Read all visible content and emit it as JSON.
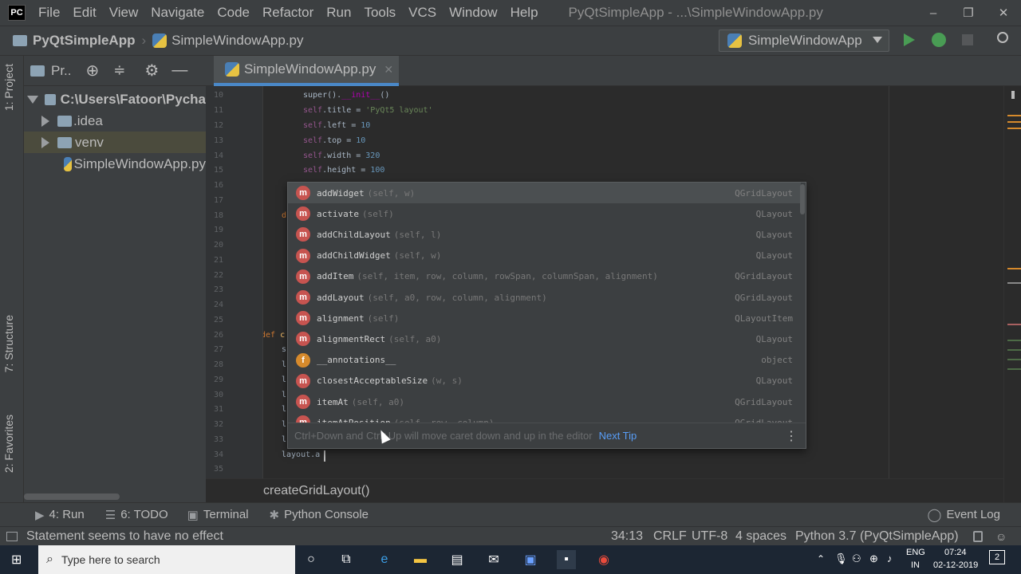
{
  "menubar": {
    "app_icon": "PC",
    "items": [
      "File",
      "Edit",
      "View",
      "Navigate",
      "Code",
      "Refactor",
      "Run",
      "Tools",
      "VCS",
      "Window",
      "Help"
    ],
    "window_title": "PyQtSimpleApp - ...\\SimpleWindowApp.py",
    "controls": {
      "minimize": "–",
      "restore": "❐",
      "close": "✕"
    }
  },
  "navbar": {
    "project": "PyQtSimpleApp",
    "file": "SimpleWindowApp.py",
    "run_config": "SimpleWindowApp"
  },
  "left_stripe": {
    "project_tab": "1: Project",
    "structure_tab": "7: Structure",
    "favorites_tab": "2: Favorites"
  },
  "project_panel": {
    "title": "Pr..",
    "tree": [
      {
        "label": "C:\\Users\\Fatoor\\Pycha",
        "type": "folder",
        "expanded": true
      },
      {
        "label": ".idea",
        "type": "folder",
        "expanded": false
      },
      {
        "label": "venv",
        "type": "folder",
        "expanded": false
      },
      {
        "label": "SimpleWindowApp.py",
        "type": "python-file"
      }
    ]
  },
  "editor": {
    "tab_label": "SimpleWindowApp.py",
    "line_numbers": [
      "10",
      "11",
      "12",
      "13",
      "14",
      "15",
      "16",
      "17",
      "18",
      "19",
      "20",
      "21",
      "22",
      "23",
      "24",
      "25",
      "26",
      "27",
      "28",
      "29",
      "30",
      "31",
      "32",
      "33",
      "34",
      "35"
    ],
    "code": {
      "l10_a": "super().",
      "l10_b": "__init__",
      "l10_c": "()",
      "l11_a": "self",
      "l11_b": ".title = ",
      "l11_c": "'PyQt5 layout'",
      "l12_a": "self",
      "l12_b": ".left = ",
      "l12_c": "10",
      "l13_a": "self",
      "l13_b": ".top = ",
      "l13_c": "10",
      "l14_a": "self",
      "l14_b": ".width = ",
      "l14_c": "320",
      "l15_a": "self",
      "l15_b": ".height = ",
      "l15_c": "100",
      "l18": "d",
      "l26_kw": "def",
      "l26_name": " c",
      "l27": "s",
      "l28": "l",
      "l29": "l",
      "l30": "l",
      "l31": "l",
      "l32": "l",
      "l33": "l",
      "l34": "layout.a"
    },
    "breadcrumb": "createGridLayout()"
  },
  "completion": {
    "items": [
      {
        "kind": "m",
        "name": "addWidget",
        "sig": "(self, w)",
        "type": "QGridLayout",
        "selected": true
      },
      {
        "kind": "m",
        "name": "activate",
        "sig": "(self)",
        "type": "QLayout"
      },
      {
        "kind": "m",
        "name": "addChildLayout",
        "sig": "(self, l)",
        "type": "QLayout"
      },
      {
        "kind": "m",
        "name": "addChildWidget",
        "sig": "(self, w)",
        "type": "QLayout"
      },
      {
        "kind": "m",
        "name": "addItem",
        "sig": "(self, item, row, column, rowSpan, columnSpan, alignment)",
        "type": "QGridLayout"
      },
      {
        "kind": "m",
        "name": "addLayout",
        "sig": "(self, a0, row, column, alignment)",
        "type": "QGridLayout"
      },
      {
        "kind": "m",
        "name": "alignment",
        "sig": "(self)",
        "type": "QLayoutItem"
      },
      {
        "kind": "m",
        "name": "alignmentRect",
        "sig": "(self, a0)",
        "type": "QLayout"
      },
      {
        "kind": "f",
        "name": "__annotations__",
        "sig": "",
        "type": "object"
      },
      {
        "kind": "m",
        "name": "closestAcceptableSize",
        "sig": "(w, s)",
        "type": "QLayout"
      },
      {
        "kind": "m",
        "name": "itemAt",
        "sig": "(self, a0)",
        "type": "QGridLayout"
      },
      {
        "kind": "m",
        "name": "itemAtPosition",
        "sig": "(self, row, column)",
        "type": "QGridLayout"
      }
    ],
    "footer_hint": "Ctrl+Down and Ctrl+Up will move caret down and up in the editor",
    "next_tip": "Next Tip"
  },
  "bottom_tabs": {
    "run": "4: Run",
    "todo": "6: TODO",
    "terminal": "Terminal",
    "python_console": "Python Console",
    "event_log": "Event Log"
  },
  "statusbar": {
    "message": "Statement seems to have no effect",
    "position": "34:13",
    "line_sep": "CRLF",
    "encoding": "UTF-8",
    "indent": "4 spaces",
    "interpreter": "Python 3.7 (PyQtSimpleApp)"
  },
  "taskbar": {
    "search_placeholder": "Type here to search",
    "language": "ENG",
    "region": "IN",
    "time": "07:24",
    "date": "02-12-2019",
    "notifications": "2"
  },
  "colors": {
    "accent": "#4a88c7",
    "method_badge": "#c75450",
    "field_badge": "#d68a2c",
    "run_green": "#499c54",
    "link": "#589df6"
  }
}
